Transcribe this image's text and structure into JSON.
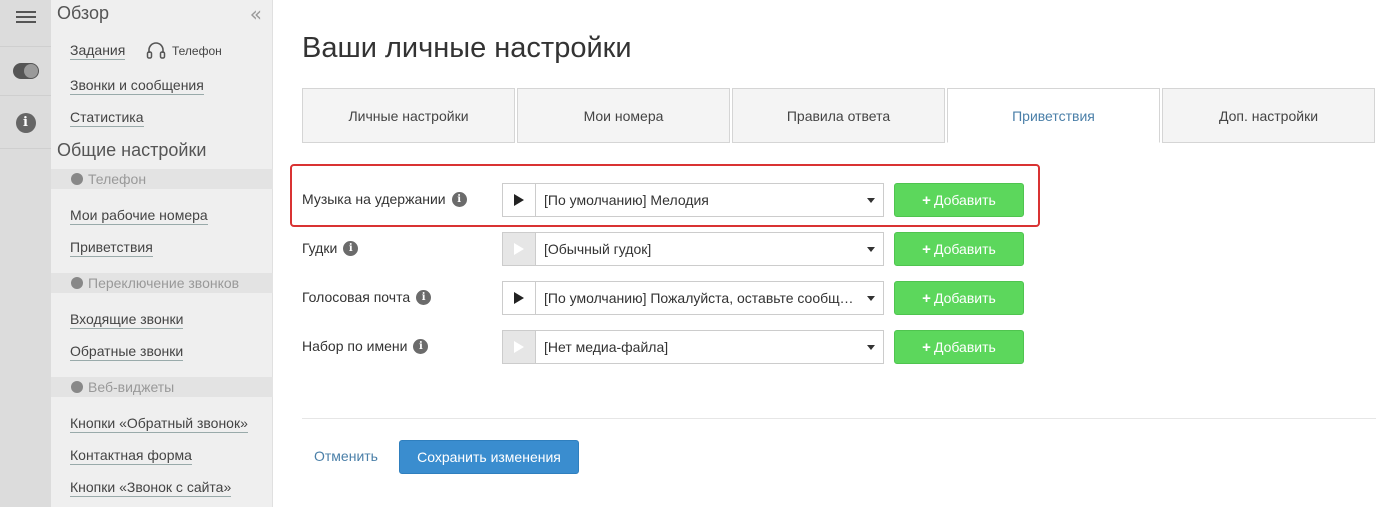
{
  "sidebar": {
    "title": "Обзор",
    "links_top": [
      "Задания",
      "Звонки и сообщения",
      "Статистика"
    ],
    "phone_label": "Телефон",
    "section_title": "Общие настройки",
    "groups": [
      {
        "title": "Телефон",
        "icon": "phone-icon",
        "items": [
          "Мои рабочие номера",
          "Приветствия"
        ]
      },
      {
        "title": "Переключение звонков",
        "icon": "transfer-icon",
        "items": [
          "Входящие звонки",
          "Обратные звонки"
        ]
      },
      {
        "title": "Веб-виджеты",
        "icon": "globe-icon",
        "items": [
          "Кнопки «Обратный звонок»",
          "Контактная форма",
          "Кнопки «Звонок с сайта»"
        ]
      }
    ]
  },
  "main": {
    "title": "Ваши личные настройки",
    "tabs": [
      {
        "label": "Личные настройки",
        "active": false
      },
      {
        "label": "Мои номера",
        "active": false
      },
      {
        "label": "Правила ответа",
        "active": false
      },
      {
        "label": "Приветствия",
        "active": true
      },
      {
        "label": "Доп. настройки",
        "active": false
      }
    ],
    "rows": [
      {
        "label": "Музыка на удержании",
        "value": "[По умолчанию] Мелодия",
        "play_enabled": true,
        "add_label": "Добавить"
      },
      {
        "label": "Гудки",
        "value": "[Обычный гудок]",
        "play_enabled": false,
        "add_label": "Добавить"
      },
      {
        "label": "Голосовая почта",
        "value": "[По умолчанию] Пожалуйста, оставьте сообщение",
        "play_enabled": true,
        "add_label": "Добавить"
      },
      {
        "label": "Набор по имени",
        "value": "[Нет медиа-файла]",
        "play_enabled": false,
        "add_label": "Добавить"
      }
    ],
    "cancel_label": "Отменить",
    "save_label": "Сохранить изменения"
  },
  "colors": {
    "accent_blue": "#3a8dcf",
    "add_green": "#5cd75c",
    "highlight_red": "#d93333",
    "active_tab_text": "#4a7fa8"
  }
}
